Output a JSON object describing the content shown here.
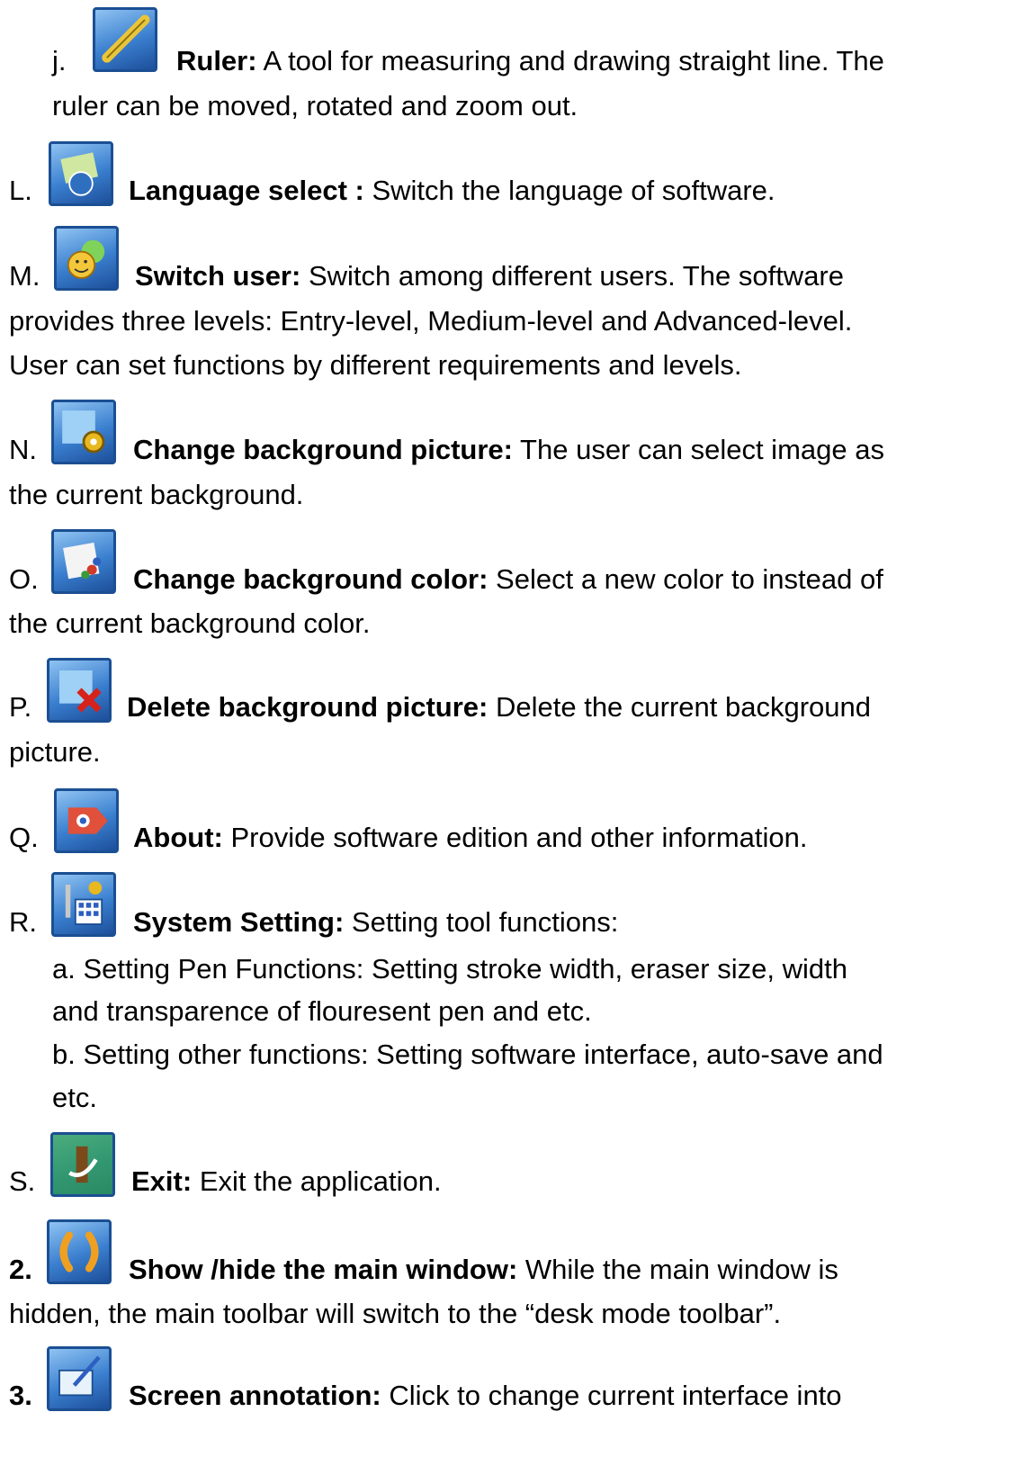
{
  "items": [
    {
      "marker": "j.",
      "icon": "ruler-icon",
      "title": "Ruler:",
      "text": "A tool for measuring and drawing straight line. The",
      "cont": [
        "ruler can be moved, rotated and zoom out."
      ]
    },
    {
      "marker": "L.",
      "icon": "language-globe-icon",
      "title": "Language select :",
      "text": "Switch the language of software."
    },
    {
      "marker": "M.",
      "icon": "switch-user-icon",
      "title": "Switch user:",
      "text": "Switch among different users. The software",
      "cont": [
        "provides three levels: Entry-level, Medium-level and Advanced-level.",
        "User can set functions by different requirements and levels."
      ]
    },
    {
      "marker": "N.",
      "icon": "background-picture-icon",
      "title": "Change background picture:",
      "text": "The user can select image as",
      "cont": [
        "the current background."
      ]
    },
    {
      "marker": "O.",
      "icon": "background-color-icon",
      "title": "Change background color:",
      "text": "Select a new color to instead of",
      "cont": [
        "the current background color."
      ]
    },
    {
      "marker": "P.",
      "icon": "delete-background-icon",
      "title": "Delete background picture:",
      "text": "Delete the current background",
      "cont": [
        "picture."
      ]
    },
    {
      "marker": "Q.",
      "icon": "about-icon",
      "title": "About:",
      "text": "Provide software edition and other information."
    },
    {
      "marker": "R.",
      "icon": "system-setting-icon",
      "title": "System Setting:",
      "text": "Setting tool functions:",
      "sub": [
        "a. Setting Pen Functions: Setting stroke width, eraser size, width",
        "and transparence of flouresent pen and etc.",
        "b. Setting other functions: Setting software interface, auto-save and",
        "etc."
      ]
    },
    {
      "marker": "S.",
      "icon": "exit-icon",
      "title": "Exit:",
      "text": "Exit the application."
    },
    {
      "marker": "2.",
      "icon": "show-hide-window-icon",
      "title": "Show /hide the main window:",
      "text": "While the main window is",
      "cont": [
        "hidden, the main toolbar will switch to the “desk mode toolbar”."
      ]
    },
    {
      "marker": "3.",
      "icon": "screen-annotation-icon",
      "title": "Screen annotation:",
      "text": "Click to change current interface into"
    }
  ]
}
